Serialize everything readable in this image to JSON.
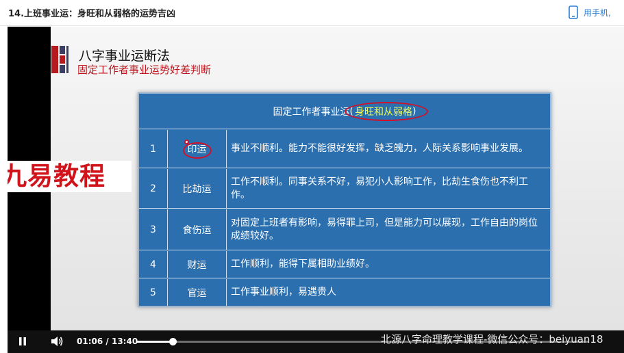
{
  "header": {
    "lesson_title": "14.上班事业运：身旺和从弱格的运势吉凶",
    "mobile_link": "用手机,"
  },
  "slide": {
    "title": "八字事业运断法",
    "subtitle": "固定工作者事业运势好差判断",
    "brand": "九易教程",
    "table_header_main": "固定工作者事业运",
    "table_header_paren_open": "(",
    "table_header_highlight": "身旺和从弱格",
    "table_header_paren_close": ")",
    "rows": [
      {
        "num": "1",
        "name": "印运",
        "desc": "事业不顺利。能力不能很好发挥，缺乏魄力，人际关系影响事业发展。"
      },
      {
        "num": "2",
        "name": "比劫运",
        "desc": "工作不顺利。同事关系不好，易犯小人影响工作，比劫生食伤也不利工作。"
      },
      {
        "num": "3",
        "name": "食伤运",
        "desc": "对固定上班者有影响，易得罪上司，但是能力可以展现，工作自由的岗位成绩较好。"
      },
      {
        "num": "4",
        "name": "财运",
        "desc": "工作顺利，能得下属相助业绩好。"
      },
      {
        "num": "5",
        "name": "官运",
        "desc": "工作事业顺利，易遇贵人"
      }
    ],
    "watermark": "北源八字命理教学课程-微信公众号：beiyuan18"
  },
  "player": {
    "current_time": "01:06",
    "time_separator": "/",
    "total_time": "13:40",
    "progress": 0.0805
  },
  "colors": {
    "accent_blue": "#2d7fd3",
    "table_blue": "#2c6fae",
    "brand_red": "#d1141c",
    "highlight_yellow": "#f6ff57"
  },
  "icons": {
    "phone": "phone-icon",
    "play": "pause-icon",
    "volume": "volume-icon"
  }
}
